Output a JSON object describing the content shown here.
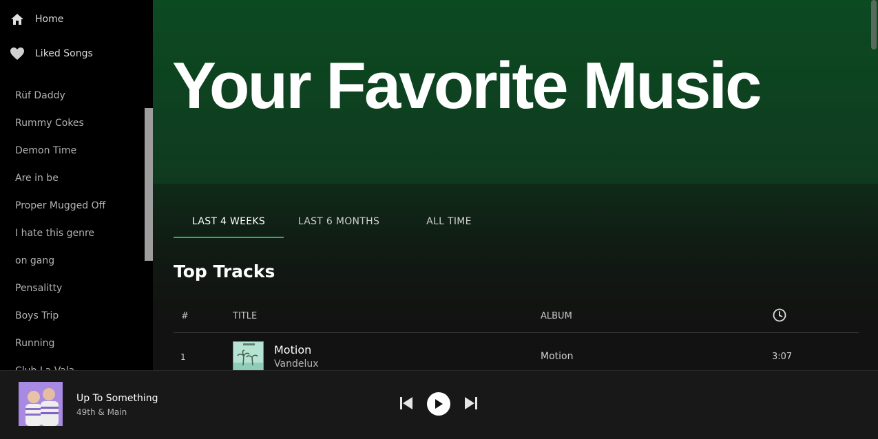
{
  "sidebar": {
    "nav": [
      {
        "label": "Home",
        "icon": "home-icon"
      },
      {
        "label": "Liked Songs",
        "icon": "heart-icon"
      }
    ],
    "playlists": [
      "Rüf Daddy",
      "Rummy Cokes",
      "Demon Time",
      "Are in be",
      "Proper Mugged Off",
      "I hate this genre",
      "on gang",
      "Pensalitty",
      "Boys Trip",
      "Running",
      "Club La Vala"
    ]
  },
  "main": {
    "hero_title": "Your Favorite Music",
    "tabs": [
      {
        "label": "LAST 4 WEEKS",
        "active": true
      },
      {
        "label": "LAST 6 MONTHS",
        "active": false
      },
      {
        "label": "ALL TIME",
        "active": false
      }
    ],
    "section_title": "Top Tracks",
    "table": {
      "headers": {
        "num": "#",
        "title": "TITLE",
        "album": "ALBUM",
        "duration_icon": "clock-icon"
      },
      "rows": [
        {
          "num": "1",
          "title": "Motion",
          "artist": "Vandelux",
          "album": "Motion",
          "duration": "3:07"
        }
      ]
    }
  },
  "player": {
    "title": "Up To Something",
    "artist": "49th & Main",
    "controls": [
      "previous-icon",
      "play-icon",
      "next-icon"
    ]
  },
  "colors": {
    "accent": "#1db954",
    "sidebar_bg": "#000000",
    "player_bg": "#181818",
    "hero_green": "#0d4a20"
  }
}
